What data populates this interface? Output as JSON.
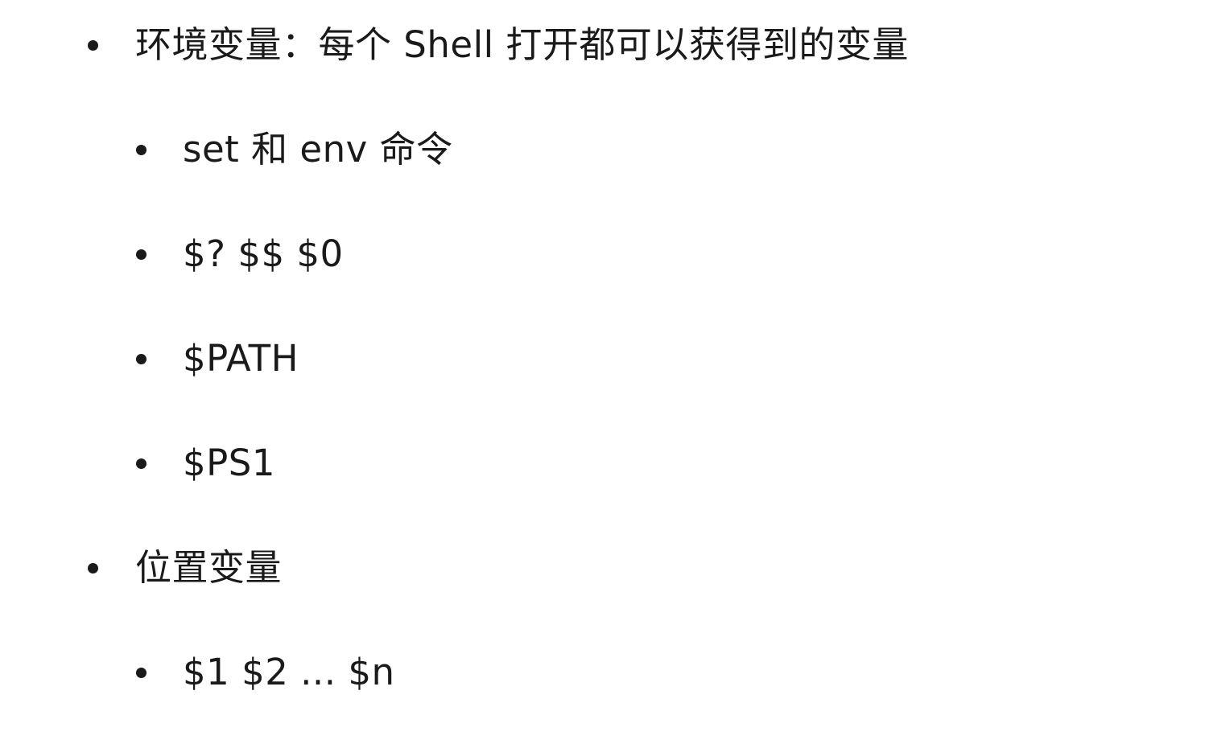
{
  "outline": {
    "items": [
      {
        "text": "环境变量：每个 Shell 打开都可以获得到的变量"
      },
      {
        "text": "set 和 env 命令"
      },
      {
        "text": "$? $$ $0"
      },
      {
        "text": "$PATH"
      },
      {
        "text": "$PS1"
      },
      {
        "text": "位置变量"
      },
      {
        "text": "$1 $2 ... $n"
      }
    ]
  }
}
